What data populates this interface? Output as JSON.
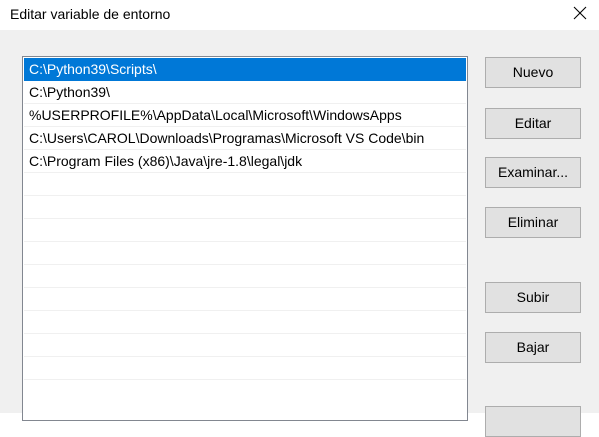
{
  "window": {
    "title": "Editar variable de entorno",
    "close_glyph": "close-icon"
  },
  "list": {
    "items": [
      {
        "label": "C:\\Python39\\Scripts\\",
        "selected": true
      },
      {
        "label": "C:\\Python39\\",
        "selected": false
      },
      {
        "label": "%USERPROFILE%\\AppData\\Local\\Microsoft\\WindowsApps",
        "selected": false
      },
      {
        "label": "C:\\Users\\CAROL\\Downloads\\Programas\\Microsoft VS Code\\bin",
        "selected": false
      },
      {
        "label": "C:\\Program Files (x86)\\Java\\jre-1.8\\legal\\jdk",
        "selected": false
      }
    ],
    "empty_rows": 9
  },
  "buttons": {
    "nuevo": "Nuevo",
    "editar": "Editar",
    "examinar": "Examinar...",
    "eliminar": "Eliminar",
    "subir": "Subir",
    "bajar": "Bajar"
  },
  "colors": {
    "selection": "#0078d7",
    "dialog_bg": "#f0f0f0",
    "button_bg": "#e1e1e1",
    "button_border": "#adadad"
  }
}
